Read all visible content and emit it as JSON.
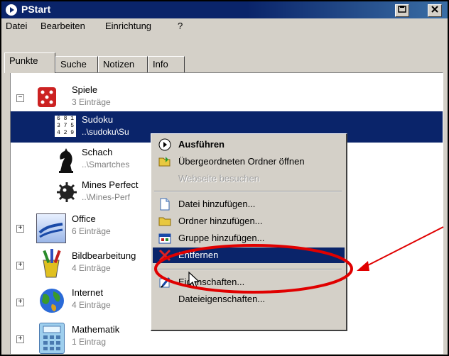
{
  "window": {
    "title": "PStart"
  },
  "menu": [
    "Datei",
    "Bearbeiten",
    "Einrichtung",
    "?"
  ],
  "tabs": [
    "Punkte",
    "Suche",
    "Notizen",
    "Info"
  ],
  "tree": {
    "spiele": {
      "name": "Spiele",
      "sub": "3 Einträge",
      "expander": "−"
    },
    "sudoku": {
      "name": "Sudoku",
      "sub": "..\\sudoku\\Su",
      "grid": [
        "6 8 1",
        "3 7 5",
        "4 2 9"
      ]
    },
    "schach": {
      "name": "Schach",
      "sub": "..\\Smartches"
    },
    "mines": {
      "name": "Mines Perfect",
      "sub": "..\\Mines-Perf"
    },
    "office": {
      "name": "Office",
      "sub": "6 Einträge",
      "expander": "+"
    },
    "bild": {
      "name": "Bildbearbeitung",
      "sub": "4 Einträge",
      "expander": "+"
    },
    "internet": {
      "name": "Internet",
      "sub": "4 Einträge",
      "expander": "+"
    },
    "mathe": {
      "name": "Mathematik",
      "sub": "1 Eintrag",
      "expander": "+"
    }
  },
  "context_menu": {
    "run": "Ausführen",
    "open_parent": "Übergeordneten Ordner öffnen",
    "visit_web": "Webseite besuchen",
    "add_file": "Datei hinzufügen...",
    "add_folder": "Ordner hinzufügen...",
    "add_group": "Gruppe hinzufügen...",
    "remove": "Entfernen",
    "properties": "Eigenschaften...",
    "file_properties": "Dateieigenschaften..."
  },
  "colors": {
    "selection": "#0a246a",
    "annotation": "#e00000",
    "face": "#d4d0c8"
  }
}
